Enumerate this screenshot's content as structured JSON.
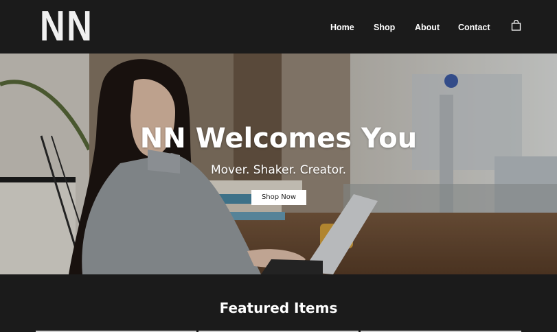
{
  "header": {
    "logo": "NN",
    "nav": [
      {
        "label": "Home"
      },
      {
        "label": "Shop"
      },
      {
        "label": "About"
      },
      {
        "label": "Contact"
      }
    ],
    "cart_icon": "shopping-bag-icon"
  },
  "hero": {
    "title": "NN Welcomes You",
    "subtitle": "Mover. Shaker. Creator.",
    "button_label": "Shop Now",
    "image": "woman-working-on-laptop-in-cafe"
  },
  "featured": {
    "title": "Featured Items"
  },
  "colors": {
    "header_bg": "#1b1b1b",
    "button_bg": "#ffffff",
    "text": "#ffffff"
  }
}
